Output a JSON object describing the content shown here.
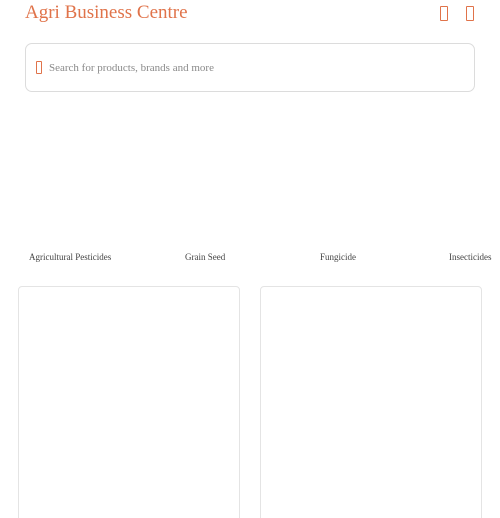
{
  "header": {
    "brand": "Agri Business Centre",
    "icons": [
      "cart-icon",
      "menu-icon"
    ],
    "accent_color": "#e0734a"
  },
  "search": {
    "placeholder": "Search for products, brands and more",
    "value": "",
    "icon": "search-icon"
  },
  "categories": [
    {
      "label": "Agricultural Pesticides"
    },
    {
      "label": "Grain Seed"
    },
    {
      "label": "Fungicide"
    },
    {
      "label": "Insecticides"
    }
  ],
  "products": [
    {
      "name": ""
    },
    {
      "name": ""
    }
  ]
}
